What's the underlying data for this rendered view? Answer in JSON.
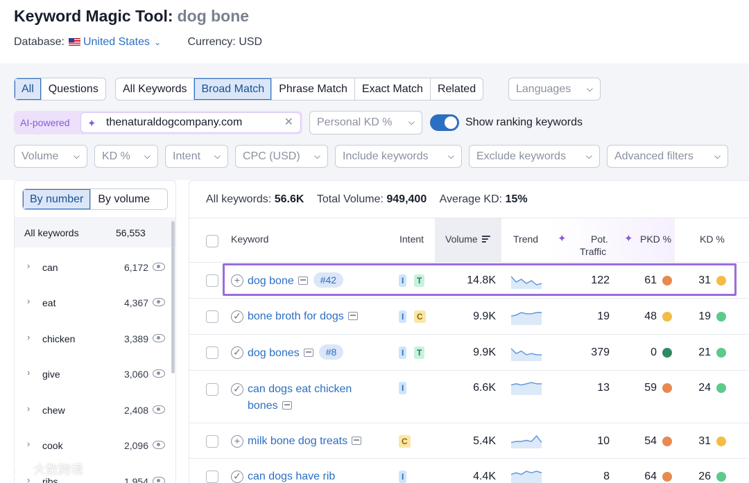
{
  "header": {
    "title": "Keyword Magic Tool:",
    "query": "dog bone",
    "database_label": "Database:",
    "database_value": "United States",
    "currency_label": "Currency: USD"
  },
  "filters": {
    "type_tabs": [
      "All",
      "Questions"
    ],
    "match_tabs": [
      "All Keywords",
      "Broad Match",
      "Phrase Match",
      "Exact Match",
      "Related"
    ],
    "languages_placeholder": "Languages",
    "ai_label": "AI-powered",
    "domain_value": "thenaturaldogcompany.com",
    "personal_kd": "Personal KD %",
    "show_ranking_label": "Show ranking keywords",
    "dropdowns": [
      "Volume",
      "KD %",
      "Intent",
      "CPC (USD)",
      "Include keywords",
      "Exclude keywords",
      "Advanced filters"
    ]
  },
  "sidebar": {
    "tabs": [
      "By number",
      "By volume"
    ],
    "all_label": "All keywords",
    "all_count": "56,553",
    "groups": [
      {
        "label": "can",
        "count": "6,172"
      },
      {
        "label": "eat",
        "count": "4,367"
      },
      {
        "label": "chicken",
        "count": "3,389"
      },
      {
        "label": "give",
        "count": "3,060"
      },
      {
        "label": "chew",
        "count": "2,408"
      },
      {
        "label": "cook",
        "count": "2,096"
      },
      {
        "label": "ribs",
        "count": "1,954"
      }
    ]
  },
  "summary": {
    "all_keywords_label": "All keywords:",
    "all_keywords_value": "56.6K",
    "total_volume_label": "Total Volume:",
    "total_volume_value": "949,400",
    "avg_kd_label": "Average KD:",
    "avg_kd_value": "15%"
  },
  "table": {
    "headers": {
      "keyword": "Keyword",
      "intent": "Intent",
      "volume": "Volume",
      "trend": "Trend",
      "pot_traffic_1": "Pot.",
      "pot_traffic_2": "Traffic",
      "pkd": "PKD %",
      "kd": "KD %"
    },
    "rows": [
      {
        "keyword": "dog bone",
        "keyword_line2": "",
        "rank": "#42",
        "intents": [
          "I",
          "T"
        ],
        "volume": "14.8K",
        "pot_traffic": "122",
        "pkd": "61",
        "pkd_color": "#e8894f",
        "kd": "31",
        "kd_color": "#f2bd42",
        "trend": [
          8,
          4,
          6,
          3,
          5,
          2,
          3
        ],
        "icon": "plus"
      },
      {
        "keyword": "bone broth for dogs",
        "keyword_line2": "",
        "rank": "",
        "intents": [
          "I",
          "C"
        ],
        "volume": "9.9K",
        "pot_traffic": "19",
        "pkd": "48",
        "pkd_color": "#f2bd42",
        "kd": "19",
        "kd_color": "#5cc98d",
        "trend": [
          6,
          7,
          9,
          8,
          8,
          9,
          9
        ],
        "icon": "check"
      },
      {
        "keyword": "dog bones",
        "keyword_line2": "",
        "rank": "#8",
        "intents": [
          "I",
          "T"
        ],
        "volume": "9.9K",
        "pot_traffic": "379",
        "pkd": "0",
        "pkd_color": "#2f8a64",
        "kd": "21",
        "kd_color": "#5cc98d",
        "trend": [
          9,
          5,
          7,
          4,
          5,
          4,
          4
        ],
        "icon": "check"
      },
      {
        "keyword": "can dogs eat chicken",
        "keyword_line2": "bones",
        "rank": "",
        "intents": [
          "I"
        ],
        "volume": "6.6K",
        "pot_traffic": "13",
        "pkd": "59",
        "pkd_color": "#e8894f",
        "kd": "24",
        "kd_color": "#5cc98d",
        "trend": [
          7,
          8,
          7,
          8,
          9,
          8,
          8
        ],
        "icon": "check"
      },
      {
        "keyword": "milk bone dog treats",
        "keyword_line2": "",
        "rank": "",
        "intents": [
          "C"
        ],
        "volume": "5.4K",
        "pot_traffic": "10",
        "pkd": "54",
        "pkd_color": "#e8894f",
        "kd": "31",
        "kd_color": "#f2bd42",
        "trend": [
          4,
          5,
          5,
          6,
          5,
          10,
          4
        ],
        "icon": "plus"
      },
      {
        "keyword": "can dogs have rib",
        "keyword_line2": "",
        "rank": "",
        "intents": [
          "I"
        ],
        "volume": "4.4K",
        "pot_traffic": "8",
        "pkd": "64",
        "pkd_color": "#e8894f",
        "kd": "26",
        "kd_color": "#5cc98d",
        "trend": [
          5,
          6,
          5,
          7,
          6,
          7,
          6
        ],
        "icon": "check"
      }
    ]
  },
  "watermark": "大数跨境",
  "colors": {
    "accent": "#2b6fc2",
    "ai": "#8a5bd6",
    "highlight": "#9b6be0"
  }
}
